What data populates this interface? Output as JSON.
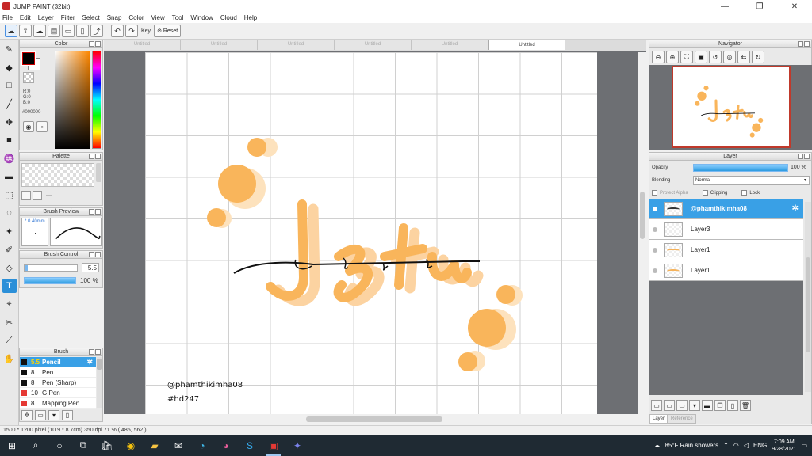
{
  "window": {
    "title": "JUMP PAINT (32bit)",
    "controls": [
      "—",
      "❐",
      "✕"
    ]
  },
  "menu": [
    "File",
    "Edit",
    "Layer",
    "Filter",
    "Select",
    "Snap",
    "Color",
    "View",
    "Tool",
    "Window",
    "Cloud",
    "Help"
  ],
  "toolbar": {
    "key_label": "Key",
    "reset_label": "Reset"
  },
  "color_panel": {
    "title": "Color",
    "rgb": [
      "R:0",
      "G:0",
      "B:0"
    ],
    "hex": "#000000",
    "foreground": "#000000",
    "background": "#ffffff"
  },
  "palette_panel": {
    "title": "Palette",
    "label": "----"
  },
  "brush_preview": {
    "title": "Brush Preview",
    "size_label": "* 0.40mm"
  },
  "brush_control": {
    "title": "Brush Control",
    "size": "5.5",
    "opacity": "100 %",
    "size_fraction": 0.06
  },
  "brush_panel": {
    "title": "Brush",
    "items": [
      {
        "size": "5.5",
        "name": "Pencil",
        "color": "#111111",
        "selected": true
      },
      {
        "size": "8",
        "name": "Pen",
        "color": "#111111"
      },
      {
        "size": "8",
        "name": "Pen (Sharp)",
        "color": "#111111"
      },
      {
        "size": "10",
        "name": "G Pen",
        "color": "#e53935"
      },
      {
        "size": "8",
        "name": "Mapping Pen",
        "color": "#e53935"
      }
    ]
  },
  "tabs": [
    "Untitled",
    "Untitled",
    "Untitled",
    "Untitled",
    "Untitled",
    "Untitled"
  ],
  "active_tab": 5,
  "canvas": {
    "signature_line1": "@phamthikimha08",
    "signature_line2": "#hd247",
    "accent": "#f9b55b"
  },
  "navigator": {
    "title": "Navigator"
  },
  "layer_panel": {
    "title": "Layer",
    "opacity_label": "Opacity",
    "opacity_value": "100 %",
    "blending_label": "Blending",
    "blending_value": "Normal",
    "protect_alpha": "Protect Alpha",
    "clipping": "Clipping",
    "lock": "Lock",
    "layers": [
      {
        "name": "@phamthikimha08",
        "selected": true
      },
      {
        "name": "Layer3"
      },
      {
        "name": "Layer1"
      },
      {
        "name": "Layer1"
      }
    ],
    "tabs": [
      "Layer",
      "Reference"
    ]
  },
  "status": {
    "text": "1500 * 1200 pixel   (10.9 * 8.7cm)   350 dpi   71 %   ( 485, 562 )"
  },
  "taskbar": {
    "weather": "85°F  Rain showers",
    "lang": "ENG",
    "time": "7:09 AM",
    "date": "9/28/2021"
  }
}
